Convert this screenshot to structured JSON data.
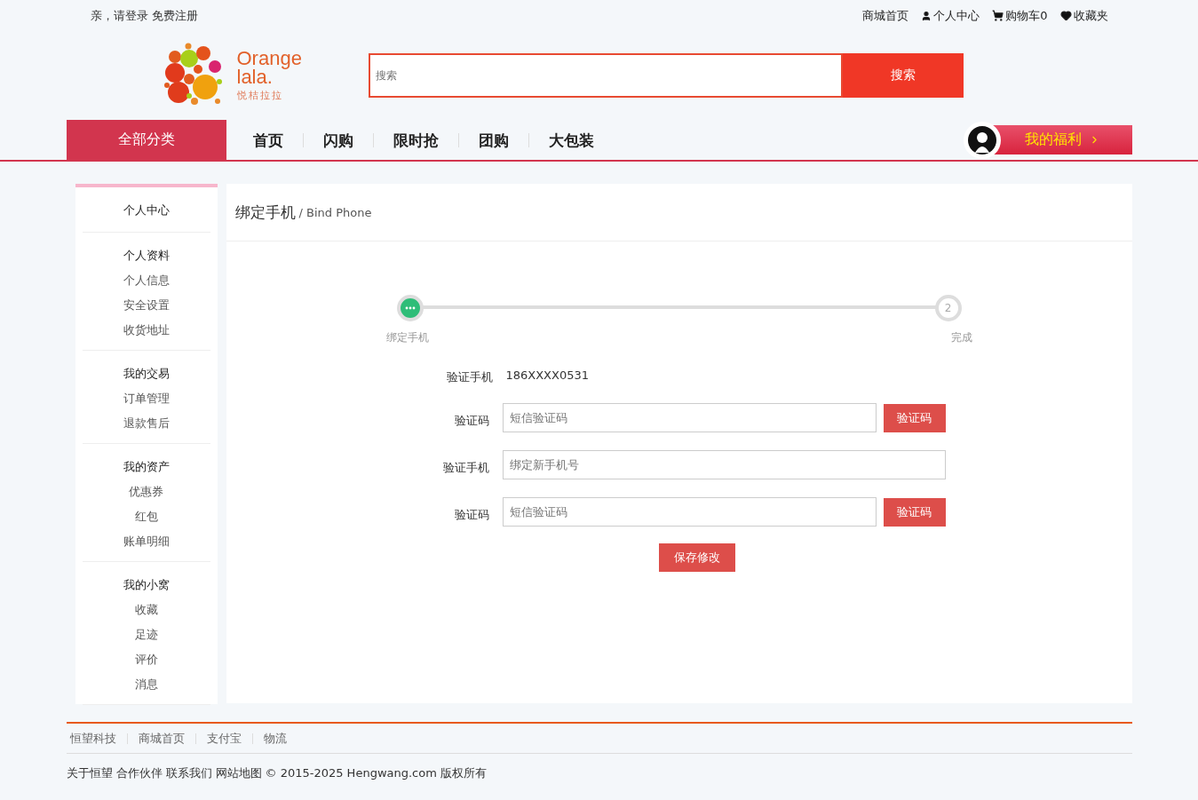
{
  "top_bar": {
    "greeting": "亲，请登录",
    "register": "免费注册",
    "links": [
      {
        "label": "商城首页",
        "kind": "plain"
      },
      {
        "label": "个人中心",
        "kind": "user"
      },
      {
        "label": "购物车0",
        "kind": "cart"
      },
      {
        "label": "收藏夹",
        "kind": "heart"
      }
    ]
  },
  "logo": {
    "line1": "Orange",
    "line2": "lala.",
    "subtitle": "悦桔拉拉"
  },
  "search": {
    "placeholder": "搜索",
    "button": "搜索"
  },
  "nav": {
    "category": "全部分类",
    "items": [
      "首页",
      "闪购",
      "限时抢",
      "团购",
      "大包装"
    ],
    "welfare": "我的福利"
  },
  "sidebar": {
    "title": "个人中心",
    "groups": [
      {
        "title": "个人资料",
        "items": [
          "个人信息",
          "安全设置",
          "收货地址"
        ]
      },
      {
        "title": "我的交易",
        "items": [
          "订单管理",
          "退款售后"
        ]
      },
      {
        "title": "我的资产",
        "items": [
          "优惠券",
          "红包",
          "账单明细"
        ]
      },
      {
        "title": "我的小窝",
        "items": [
          "收藏",
          "足迹",
          "评价",
          "消息"
        ]
      }
    ]
  },
  "panel": {
    "title": "绑定手机",
    "subtitle": "/ Bind Phone"
  },
  "steps": [
    {
      "label": "绑定手机",
      "active": true
    },
    {
      "label": "完成",
      "number": "2",
      "active": false
    }
  ],
  "form": [
    {
      "kind": "text",
      "label": "验证手机",
      "value": "186XXXX0531"
    },
    {
      "kind": "code",
      "label": "验证码",
      "placeholder": "短信验证码",
      "button": "验证码"
    },
    {
      "kind": "input",
      "label": "验证手机",
      "placeholder": "绑定新手机号"
    },
    {
      "kind": "code",
      "label": "验证码",
      "placeholder": "短信验证码",
      "button": "验证码"
    }
  ],
  "save_button": "保存修改",
  "footer": {
    "links": [
      "恒望科技",
      "商城首页",
      "支付宝",
      "物流"
    ],
    "bottom_links": [
      "关于恒望",
      "合作伙伴",
      "联系我们",
      "网站地图"
    ],
    "copyright": "© 2015-2025 Hengwang.com 版权所有"
  }
}
